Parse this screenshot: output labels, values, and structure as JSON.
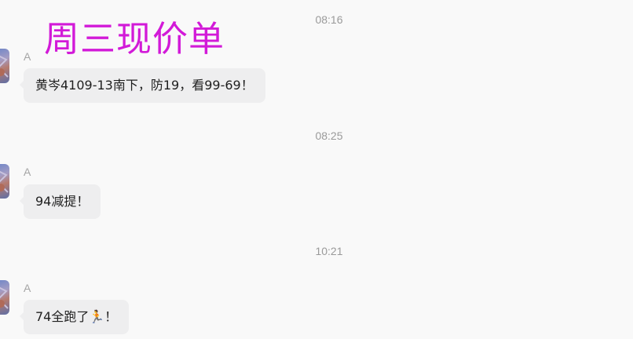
{
  "overlay": {
    "title": "周三现价单"
  },
  "messages": [
    {
      "time": "08:16",
      "sender": "A",
      "text": "黄岑4109-13南下，防19，看99-69！"
    },
    {
      "time": "08:25",
      "sender": "A",
      "text": "94减提！"
    },
    {
      "time": "10:21",
      "sender": "A",
      "text": "74全跑了🏃！"
    }
  ],
  "colors": {
    "overlay_title": "#d21ad8",
    "bubble": "#eeeeef",
    "timestamp": "#9a9a9a",
    "background": "#f9f9f9"
  },
  "icons": {
    "avatar": "user-avatar-image"
  }
}
